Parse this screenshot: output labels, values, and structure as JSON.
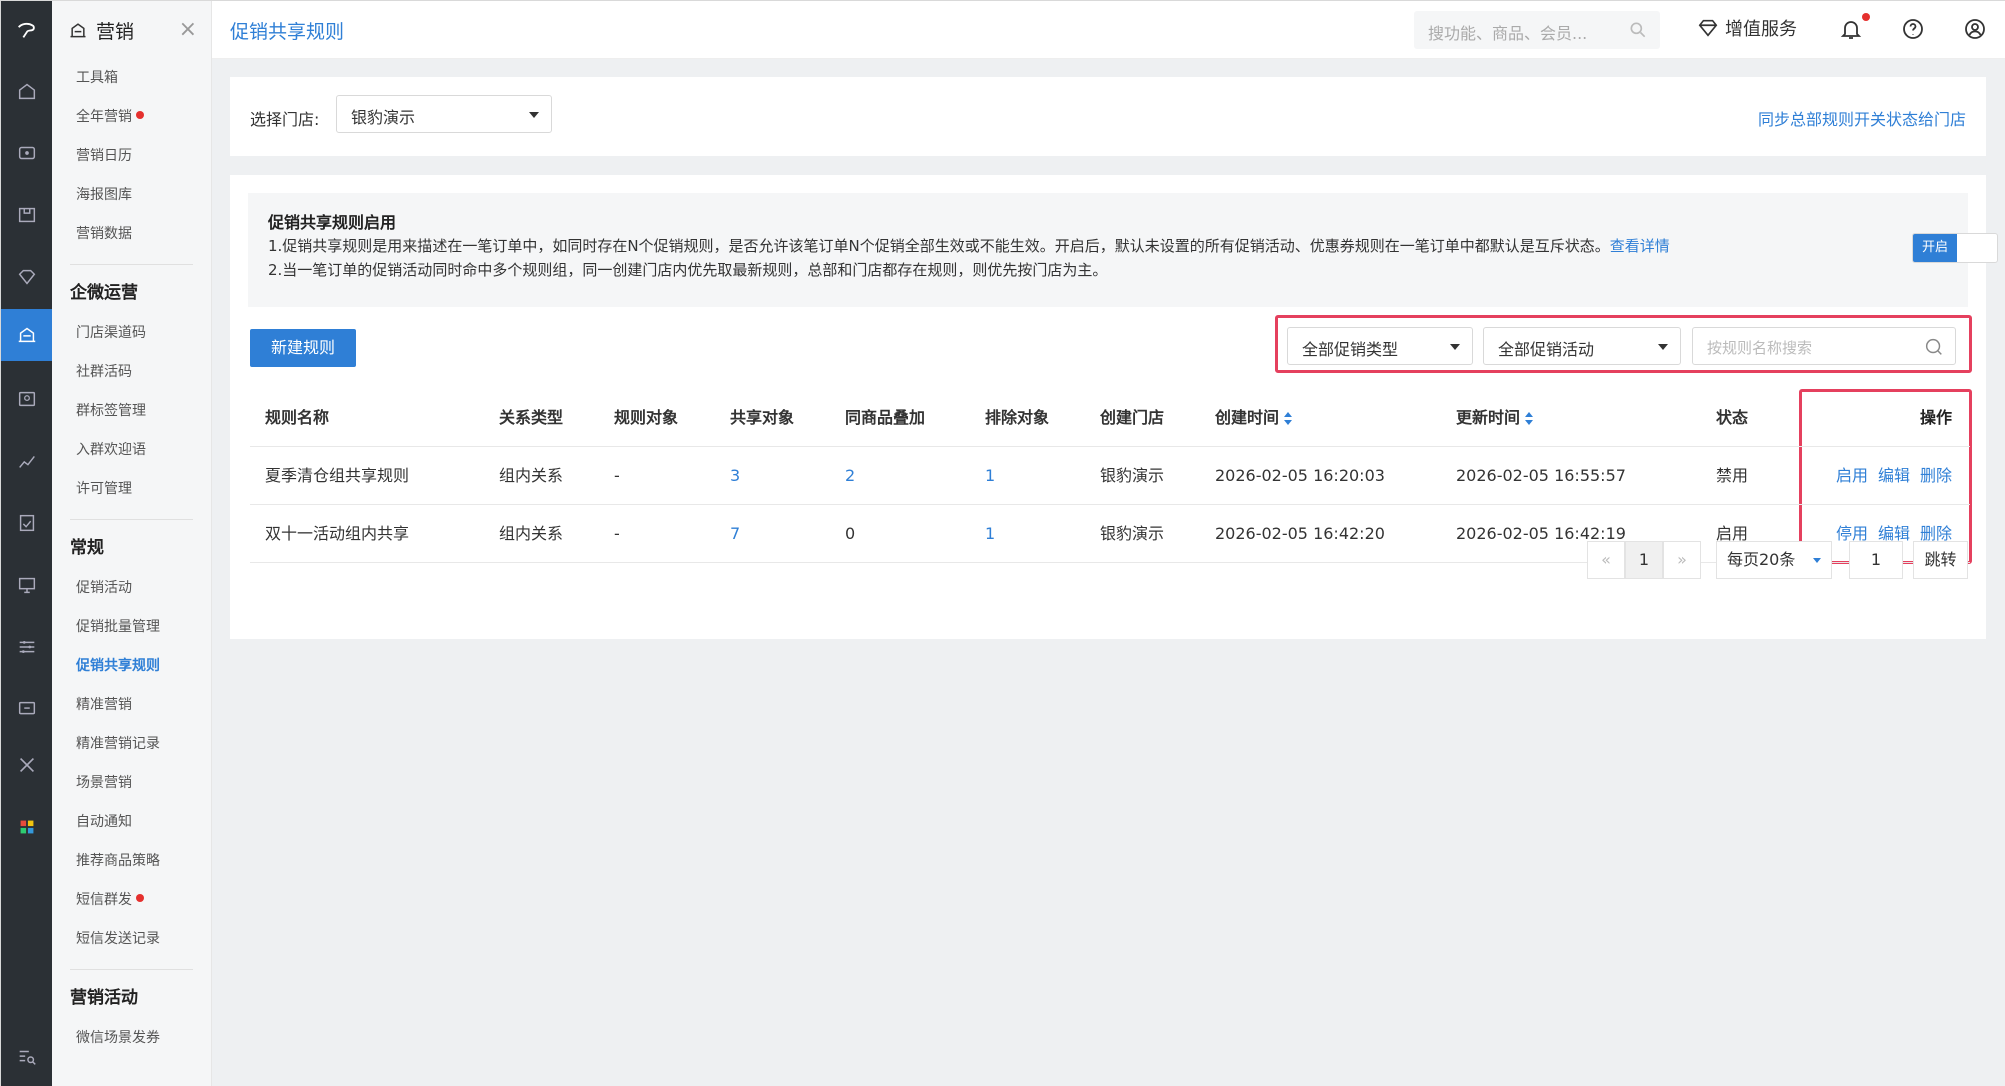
{
  "app": {
    "module_title": "营销",
    "page_title": "促销共享规则"
  },
  "topbar": {
    "search_placeholder": "搜功能、商品、会员...",
    "value_added_label": "增值服务"
  },
  "sidebar": {
    "items_a": [
      {
        "label": "工具箱",
        "dot": false
      },
      {
        "label": "全年营销",
        "dot": true
      },
      {
        "label": "营销日历",
        "dot": false
      },
      {
        "label": "海报图库",
        "dot": false
      },
      {
        "label": "营销数据",
        "dot": false
      }
    ],
    "group_b": "企微运营",
    "items_b": [
      {
        "label": "门店渠道码"
      },
      {
        "label": "社群活码"
      },
      {
        "label": "群标签管理"
      },
      {
        "label": "入群欢迎语"
      },
      {
        "label": "许可管理"
      }
    ],
    "group_c": "常规",
    "items_c": [
      {
        "label": "促销活动",
        "dot": false
      },
      {
        "label": "促销批量管理",
        "dot": false
      },
      {
        "label": "促销共享规则",
        "dot": false,
        "active": true
      },
      {
        "label": "精准营销",
        "dot": false
      },
      {
        "label": "精准营销记录",
        "dot": false
      },
      {
        "label": "场景营销",
        "dot": false
      },
      {
        "label": "自动通知",
        "dot": false
      },
      {
        "label": "推荐商品策略",
        "dot": false
      },
      {
        "label": "短信群发",
        "dot": true
      },
      {
        "label": "短信发送记录",
        "dot": false
      }
    ],
    "group_d": "营销活动",
    "items_d": [
      {
        "label": "微信场景发券"
      }
    ]
  },
  "store_filter": {
    "label": "选择门店:",
    "selected": "银豹演示",
    "sync_link": "同步总部规则开关状态给门店"
  },
  "notice": {
    "heading": "促销共享规则启用",
    "line1": "1.促销共享规则是用来描述在一笔订单中，如同时存在N个促销规则，是否允许该笔订单N个促销全部生效或不能生效。开启后，默认未设置的所有促销活动、优惠券规则在一笔订单中都默认是互斥状态。",
    "line1_link": "查看详情",
    "line2": "2.当一笔订单的促销活动同时命中多个规则组，同一创建门店内优先取最新规则，总部和门店都存在规则，则优先按门店为主。",
    "toggle_label": "开启"
  },
  "toolbar": {
    "new_rule": "新建规则",
    "type_filter": "全部促销类型",
    "activity_filter": "全部促销活动",
    "search_placeholder": "按规则名称搜索"
  },
  "table": {
    "headers": [
      "规则名称",
      "关系类型",
      "规则对象",
      "共享对象",
      "同商品叠加",
      "排除对象",
      "创建门店",
      "创建时间",
      "更新时间",
      "状态",
      "操作"
    ],
    "rows": [
      {
        "name": "夏季清仓组共享规则",
        "relation": "组内关系",
        "object": "-",
        "shared": "3",
        "stack": "2",
        "excluded": "1",
        "store": "银豹演示",
        "created": "2026-02-05 16:20:03",
        "updated": "2026-02-05 16:55:57",
        "status": "禁用",
        "op1": "启用",
        "op2": "编辑",
        "op3": "删除"
      },
      {
        "name": "双十一活动组内共享",
        "relation": "组内关系",
        "object": "-",
        "shared": "7",
        "stack": "0",
        "excluded": "1",
        "store": "银豹演示",
        "created": "2026-02-05 16:42:20",
        "updated": "2026-02-05 16:42:19",
        "status": "启用",
        "op1": "停用",
        "op2": "编辑",
        "op3": "删除"
      }
    ]
  },
  "pagination": {
    "prev": "«",
    "current": "1",
    "next": "»",
    "page_size": "每页20条",
    "jump_value": "1",
    "jump_label": "跳转"
  },
  "colors": {
    "accent": "#2f7fd6",
    "sidebar_dark": "#2b3035",
    "highlight": "#e5405e",
    "badge_red": "#e5302e"
  }
}
